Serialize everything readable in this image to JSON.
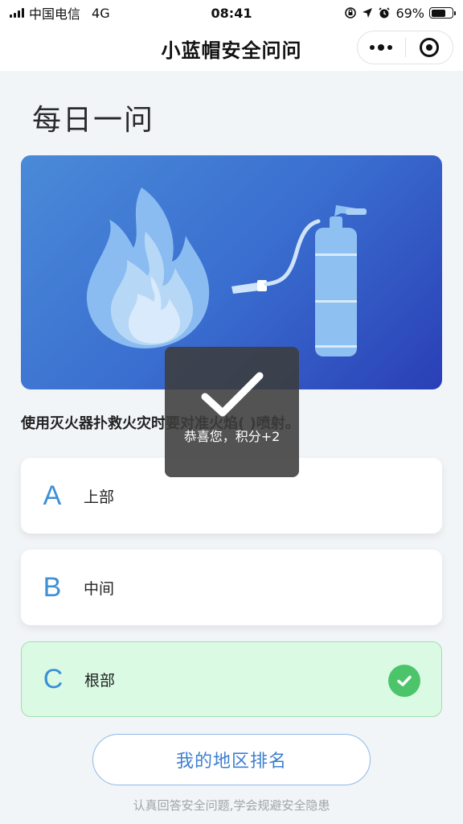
{
  "status_bar": {
    "carrier": "中国电信",
    "network": "4G",
    "time": "08:41",
    "battery": "69%",
    "battery_level": 0.69
  },
  "nav": {
    "title": "小蓝帽安全问问"
  },
  "page": {
    "heading": "每日一问"
  },
  "banner": {
    "icons": [
      "fire-icon",
      "fire-extinguisher-icon"
    ]
  },
  "question": {
    "text": "使用灭火器扑救火灾时要对准火焰( )喷射。"
  },
  "options": [
    {
      "letter": "A",
      "text": "上部",
      "state": "normal"
    },
    {
      "letter": "B",
      "text": "中间",
      "state": "normal"
    },
    {
      "letter": "C",
      "text": "根部",
      "state": "correct"
    }
  ],
  "toast": {
    "text": "恭喜您，积分+2"
  },
  "rank_button": {
    "label": "我的地区排名"
  },
  "footer": {
    "tip": "认真回答安全问题,学会规避安全隐患"
  },
  "colors": {
    "accent": "#3d8fd6",
    "correct_bg": "#dafae4",
    "correct_badge": "#4cc56a",
    "banner_start": "#4a8ad8",
    "banner_end": "#2a3fb6"
  }
}
